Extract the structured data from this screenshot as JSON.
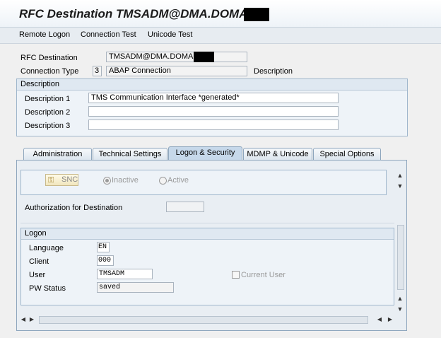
{
  "window": {
    "title": "RFC Destination TMSADM@DMA.DOMAIN_"
  },
  "menu": {
    "items": [
      "Remote Logon",
      "Connection Test",
      "Unicode Test"
    ]
  },
  "header": {
    "rfc_destination_label": "RFC Destination",
    "rfc_destination_value": "TMSADM@DMA.DOMAIN_",
    "connection_type_label": "Connection Type",
    "connection_type_code": "3",
    "connection_type_value": "ABAP Connection",
    "description_label": "Description"
  },
  "description_group": {
    "title": "Description",
    "fields": [
      {
        "label": "Description 1",
        "value": "TMS Communication Interface  *generated*"
      },
      {
        "label": "Description 2",
        "value": ""
      },
      {
        "label": "Description 3",
        "value": ""
      }
    ]
  },
  "tabs": [
    {
      "label": "Administration",
      "active": false
    },
    {
      "label": "Technical Settings",
      "active": false
    },
    {
      "label": "Logon & Security",
      "active": true
    },
    {
      "label": "MDMP & Unicode",
      "active": false
    },
    {
      "label": "Special Options",
      "active": false
    }
  ],
  "security": {
    "snc_button": "SNC",
    "snc_options": [
      {
        "label": "Inactive",
        "selected": true
      },
      {
        "label": "Active",
        "selected": false
      }
    ],
    "authorization_label": "Authorization for Destination",
    "authorization_value": ""
  },
  "logon_group": {
    "title": "Logon",
    "language_label": "Language",
    "language_value": "EN",
    "client_label": "Client",
    "client_value": "000",
    "user_label": "User",
    "user_value": "TMSADM",
    "current_user_label": "Current User",
    "current_user_checked": false,
    "pw_status_label": "PW Status",
    "pw_status_value": "saved"
  }
}
